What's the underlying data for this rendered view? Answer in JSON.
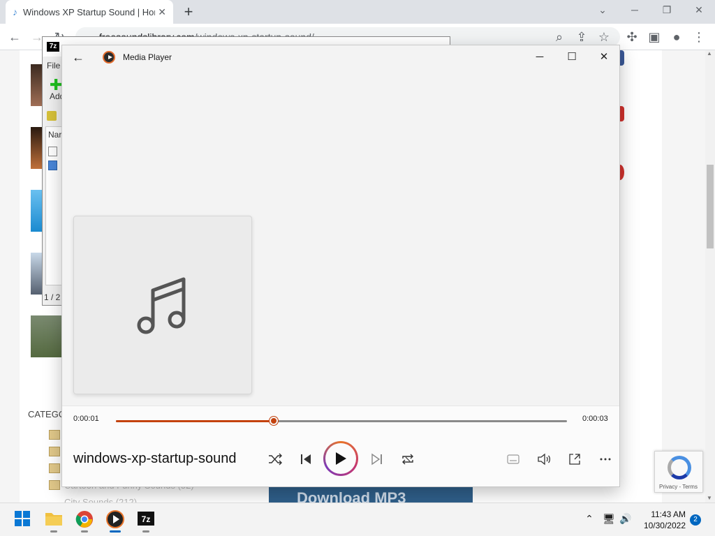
{
  "browser": {
    "tab_title": "Windows XP Startup Sound | Hor",
    "tab_close": "✕",
    "new_tab": "+",
    "url_domain": "freesoundslibrary.com",
    "url_path": "/windows-xp-startup-sound/",
    "win_minimize": "─",
    "win_restore": "❐",
    "win_close": "✕",
    "win_tabsearch": "⌄"
  },
  "website": {
    "category_heading": "CATEGO",
    "category_items": [
      "Cartoon and Funny Sounds (52)",
      "City Sounds (212)"
    ],
    "download_label": "Download MP3",
    "recaptcha_terms": "Privacy - Terms"
  },
  "zip_window": {
    "menu_file": "File",
    "add_label": "Add",
    "name_col": "Nar",
    "status": "1 / 2"
  },
  "media_player": {
    "app_title": "Media Player",
    "track_title": "windows-xp-startup-sound",
    "time_current": "0:00:01",
    "time_total": "0:00:03",
    "progress": 0.35,
    "accent_color": "#c4420e",
    "icons": [
      "back-arrow-icon",
      "shuffle-icon",
      "previous-icon",
      "play-icon",
      "next-icon",
      "repeat-icon",
      "captions-icon",
      "volume-icon",
      "miniplayer-icon",
      "more-icon"
    ]
  },
  "taskbar": {
    "time": "11:43 AM",
    "date": "10/30/2022",
    "notification_count": "2",
    "apps": [
      "windows-start",
      "file-explorer",
      "chrome",
      "media-player",
      "7-zip"
    ]
  }
}
